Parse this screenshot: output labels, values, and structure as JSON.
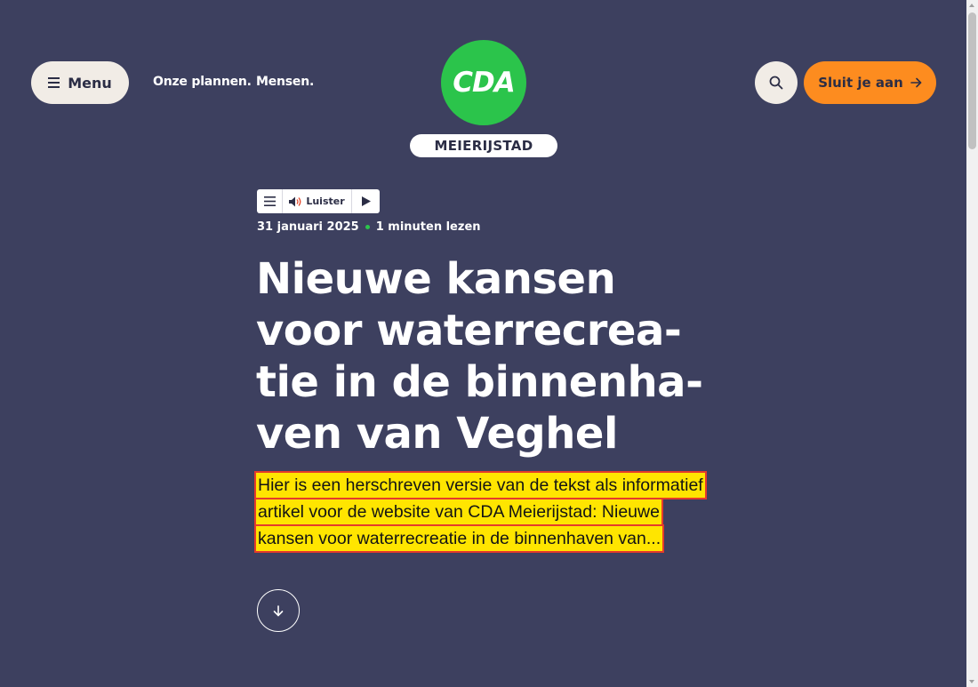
{
  "header": {
    "menu_label": "Menu",
    "nav": [
      {
        "label": "Onze plannen."
      },
      {
        "label": "Mensen."
      }
    ],
    "logo_text": "CDA",
    "logo_sub": "MEIERIJSTAD",
    "join_label": "Sluit je aan",
    "colors": {
      "background": "#3d405f",
      "logo_green": "#2bc44b",
      "cta_orange": "#fd8c1f",
      "light_button": "#f1ece6"
    }
  },
  "listen_widget": {
    "label": "Luister"
  },
  "article": {
    "date": "31 januari 2025",
    "read_time": "1 minuten lezen",
    "title_lines": [
      "Nieuwe kansen",
      "voor waterrecrea-",
      "tie in de binnenha-",
      "ven van Veghel"
    ],
    "excerpt_lines": [
      "Hier is een herschreven versie van de tekst als informatief",
      "artikel voor de website van CDA Meierijstad: Nieuwe",
      "kansen voor waterrecreatie in de binnenhaven van..."
    ],
    "excerpt_highlight_color": "#ffe500"
  },
  "icons": {
    "menu": "hamburger-icon",
    "search": "search-icon",
    "join_arrow": "arrow-right-icon",
    "listen_menu": "hamburger-icon",
    "speaker": "speaker-icon",
    "play": "play-icon",
    "scroll": "arrow-down-icon"
  }
}
